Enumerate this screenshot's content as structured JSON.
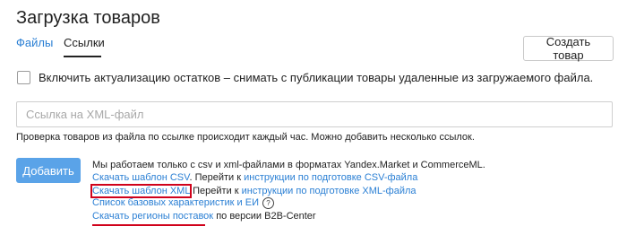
{
  "page": {
    "title": "Загрузка товаров"
  },
  "tabs": [
    {
      "label": "Файлы",
      "active": false
    },
    {
      "label": "Ссылки",
      "active": true
    }
  ],
  "header": {
    "create_button": "Создать товар"
  },
  "checkbox": {
    "checked": false,
    "label": "Включить актуализацию остатков – снимать с публикации товары удаленные из загружаемого файла."
  },
  "url_input": {
    "placeholder": "Ссылка на XML-файл",
    "value": ""
  },
  "hint": "Проверка товаров из файла по ссылке происходит каждый час. Можно добавить несколько ссылок.",
  "add_button": "Добавить",
  "info": {
    "formats_text": "Мы работаем только с csv и xml-файлами в форматах Yandex.Market и CommerceML.",
    "csv_template_link": "Скачать шаблон CSV",
    "goto_text_1": ". Перейти к",
    "csv_instructions_link": "инструкции по подготовке CSV-файла",
    "xml_template_link": "Скачать шаблон XML",
    "goto_text_2": "Перейти к",
    "xml_instructions_link": "инструкции по подготовке XML-файла",
    "base_characteristics_link": "Список базовых характеристик и ЕИ",
    "help_icon_glyph": "?",
    "regions_link": "Скачать регионы поставок",
    "regions_suffix": "по версии B2B-Center"
  },
  "colors": {
    "link": "#2a7fd4",
    "add_button_bg": "#5aa3e8",
    "highlight_red": "#d0021b"
  }
}
